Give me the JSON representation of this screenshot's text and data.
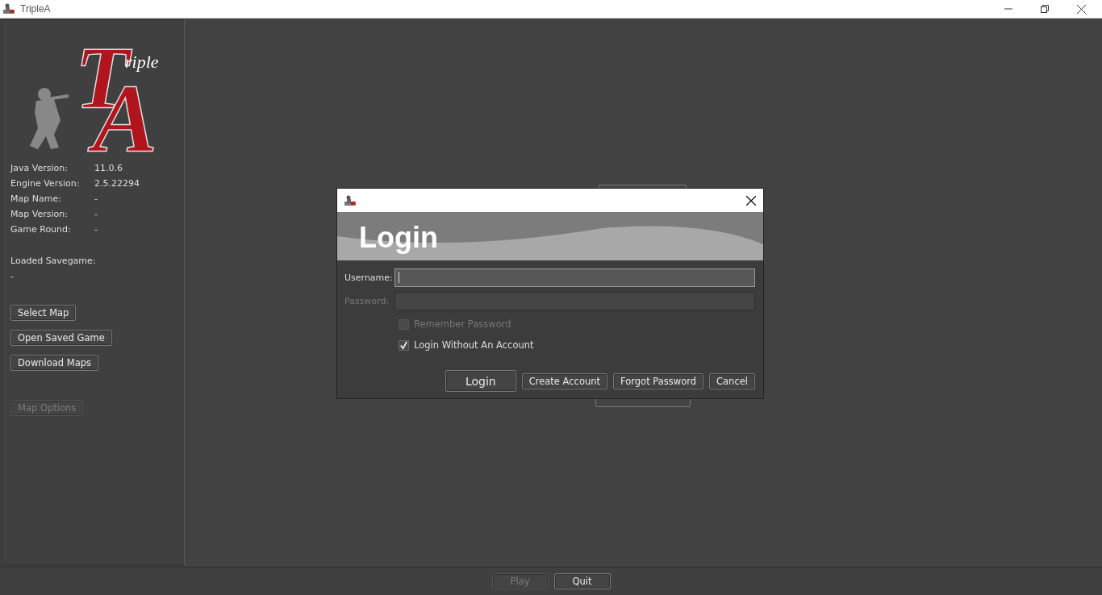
{
  "window": {
    "title": "TripleA"
  },
  "logo": {
    "letter_t": "T",
    "letter_a": "A",
    "script": "riple"
  },
  "info": [
    {
      "label": "Java Version:",
      "value": "11.0.6"
    },
    {
      "label": "Engine Version:",
      "value": "2.5.22294"
    },
    {
      "label": "Map Name:",
      "value": "-"
    },
    {
      "label": "Map Version:",
      "value": "-"
    },
    {
      "label": "Game Round:",
      "value": "-"
    }
  ],
  "savegame": {
    "label": "Loaded Savegame:",
    "value": "-"
  },
  "sidebar_buttons": [
    {
      "label": "Select Map",
      "disabled": false
    },
    {
      "label": "Open Saved Game",
      "disabled": false
    },
    {
      "label": "Download Maps",
      "disabled": false
    }
  ],
  "map_options": {
    "label": "Map Options",
    "disabled": true
  },
  "bottom_buttons": [
    {
      "label": "Play",
      "disabled": true
    },
    {
      "label": "Quit",
      "disabled": false
    }
  ],
  "dialog": {
    "title": "Login",
    "fields": [
      {
        "label": "Username:",
        "disabled": false,
        "focused": true
      },
      {
        "label": "Password:",
        "disabled": true,
        "focused": false
      }
    ],
    "checkboxes": [
      {
        "label": "Remember Password",
        "checked": false,
        "disabled": true
      },
      {
        "label": "Login Without An Account",
        "checked": true,
        "disabled": false
      }
    ],
    "buttons": [
      {
        "label": "Login",
        "kind": "primary"
      },
      {
        "label": "Create Account",
        "kind": "normal"
      },
      {
        "label": "Forgot Password",
        "kind": "normal"
      },
      {
        "label": "Cancel",
        "kind": "normal"
      }
    ]
  }
}
